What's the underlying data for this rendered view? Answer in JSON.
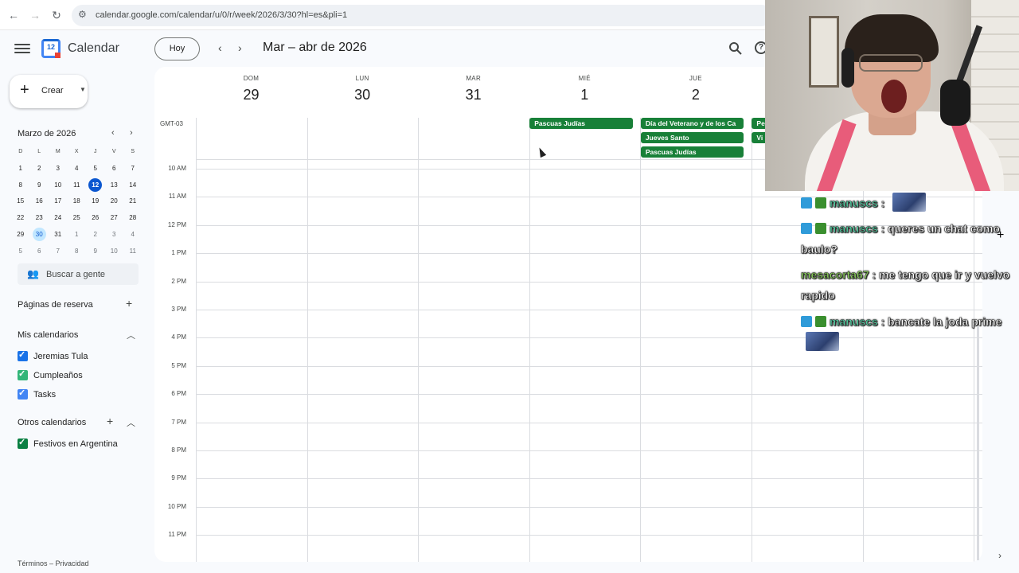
{
  "browser": {
    "back_icon": "arrow-left-icon",
    "forward_icon": "arrow-right-icon",
    "reload_icon": "reload-icon",
    "url": "calendar.google.com/calendar/u/0/r/week/2026/3/30?hl=es&pli=1"
  },
  "header": {
    "app_title": "Calendar",
    "logo_number": "12",
    "today_label": "Hoy",
    "range_title": "Mar – abr de 2026"
  },
  "sidebar": {
    "create_label": "Crear",
    "mini_calendar": {
      "title": "Marzo de 2026",
      "weekdays": [
        "D",
        "L",
        "M",
        "X",
        "J",
        "V",
        "S"
      ],
      "weeks": [
        [
          "1",
          "2",
          "3",
          "4",
          "5",
          "6",
          "7"
        ],
        [
          "8",
          "9",
          "10",
          "11",
          "12",
          "13",
          "14"
        ],
        [
          "15",
          "16",
          "17",
          "18",
          "19",
          "20",
          "21"
        ],
        [
          "22",
          "23",
          "24",
          "25",
          "26",
          "27",
          "28"
        ],
        [
          "29",
          "30",
          "31",
          "1",
          "2",
          "3",
          "4"
        ],
        [
          "5",
          "6",
          "7",
          "8",
          "9",
          "10",
          "11"
        ]
      ],
      "today": "12",
      "selected": "30"
    },
    "people_search_placeholder": "Buscar a gente",
    "booking_pages_title": "Páginas de reserva",
    "my_calendars_title": "Mis calendarios",
    "my_calendars": [
      {
        "label": "Jeremias Tula",
        "color": "#1a73e8"
      },
      {
        "label": "Cumpleaños",
        "color": "#33b679"
      },
      {
        "label": "Tasks",
        "color": "#4285f4"
      }
    ],
    "other_calendars_title": "Otros calendarios",
    "other_calendars": [
      {
        "label": "Festivos en Argentina",
        "color": "#0b8043"
      }
    ],
    "footer": "Términos – Privacidad"
  },
  "week": {
    "timezone": "GMT-03",
    "days": [
      {
        "dow": "DOM",
        "num": "29"
      },
      {
        "dow": "LUN",
        "num": "30"
      },
      {
        "dow": "MAR",
        "num": "31"
      },
      {
        "dow": "MIÉ",
        "num": "1"
      },
      {
        "dow": "JUE",
        "num": "2"
      }
    ],
    "hours": [
      "10 AM",
      "11 AM",
      "12 PM",
      "1 PM",
      "2 PM",
      "3 PM",
      "4 PM",
      "5 PM",
      "6 PM",
      "7 PM",
      "8 PM",
      "9 PM",
      "10 PM",
      "11 PM"
    ],
    "all_day_events": [
      {
        "day": "MIÉ",
        "title": "Pascuas Judías",
        "color": "#188038"
      },
      {
        "day": "JUE",
        "title": "Día del Veterano y de los Ca",
        "color": "#188038"
      },
      {
        "day": "JUE",
        "title": "Jueves Santo",
        "color": "#188038"
      },
      {
        "day": "JUE",
        "title": "Pascuas Judías",
        "color": "#188038"
      },
      {
        "day": "VIE",
        "title": "Pe",
        "color": "#188038"
      },
      {
        "day": "VIE",
        "title": "Vi",
        "color": "#188038"
      }
    ]
  },
  "stream_overlay": {
    "chat": [
      {
        "user": "manuscs",
        "text": "",
        "has_emote": true
      },
      {
        "user": "manuscs",
        "text": "queres un chat como baulo?",
        "has_emote": false
      },
      {
        "user": "mesacorta67",
        "text": "me tengo que ir y vuelvo rapido",
        "has_emote": false
      },
      {
        "user": "manuscs",
        "text": "bancate la joda prime",
        "has_emote": true
      }
    ],
    "colon": ":"
  }
}
